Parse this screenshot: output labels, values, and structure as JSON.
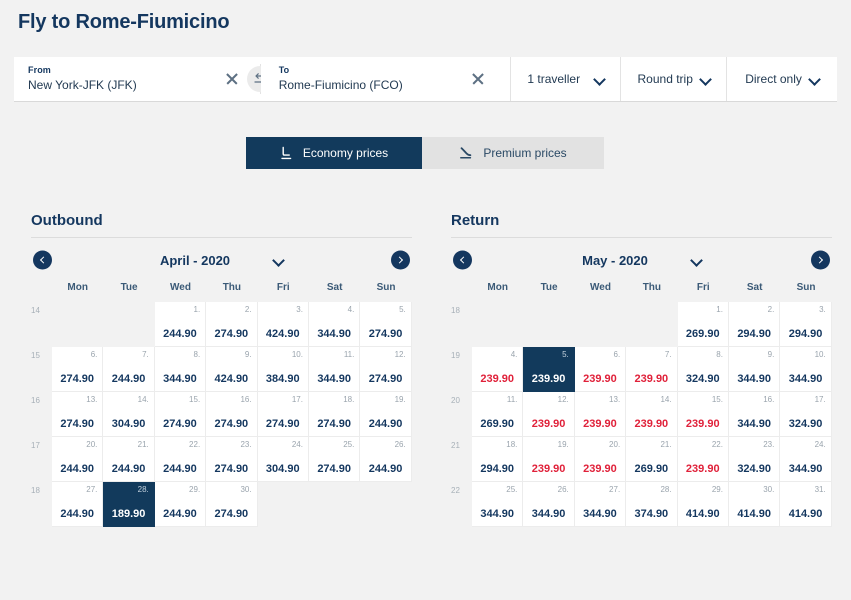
{
  "header": {
    "title": "Fly to Rome-Fiumicino"
  },
  "search": {
    "from_label": "From",
    "from_value": "New York-JFK (JFK)",
    "to_label": "To",
    "to_value": "Rome-Fiumicino (FCO)",
    "swap_icon": "swap-arrows-icon",
    "clear_icon": "close-icon",
    "travellers": "1 traveller",
    "trip_type": "Round trip",
    "direct": "Direct only"
  },
  "tabs": [
    {
      "label": "Economy prices",
      "icon": "economy-seat-icon",
      "active": true
    },
    {
      "label": "Premium prices",
      "icon": "premium-seat-icon",
      "active": false
    }
  ],
  "colors": {
    "navy": "#14375f",
    "selected": "#123a5c",
    "low_price": "#e0213a",
    "page_bg": "#f2f2f2",
    "tab_inactive": "#e2e2e2"
  },
  "calendars": [
    {
      "title": "Outbound",
      "month": "April - 2020",
      "prev_icon": "chevron-left-icon",
      "next_icon": "chevron-right-icon",
      "dropdown_icon": "chevron-down-icon",
      "dow": [
        "Mon",
        "Tue",
        "Wed",
        "Thu",
        "Fri",
        "Sat",
        "Sun"
      ],
      "weeks": [
        {
          "week": "14",
          "days": [
            null,
            null,
            {
              "d": "1.",
              "p": "244.90"
            },
            {
              "d": "2.",
              "p": "274.90"
            },
            {
              "d": "3.",
              "p": "424.90"
            },
            {
              "d": "4.",
              "p": "344.90"
            },
            {
              "d": "5.",
              "p": "274.90"
            }
          ]
        },
        {
          "week": "15",
          "days": [
            {
              "d": "6.",
              "p": "274.90"
            },
            {
              "d": "7.",
              "p": "244.90"
            },
            {
              "d": "8.",
              "p": "344.90"
            },
            {
              "d": "9.",
              "p": "424.90"
            },
            {
              "d": "10.",
              "p": "384.90"
            },
            {
              "d": "11.",
              "p": "344.90"
            },
            {
              "d": "12.",
              "p": "274.90"
            }
          ]
        },
        {
          "week": "16",
          "days": [
            {
              "d": "13.",
              "p": "274.90"
            },
            {
              "d": "14.",
              "p": "304.90"
            },
            {
              "d": "15.",
              "p": "274.90"
            },
            {
              "d": "16.",
              "p": "274.90"
            },
            {
              "d": "17.",
              "p": "274.90"
            },
            {
              "d": "18.",
              "p": "274.90"
            },
            {
              "d": "19.",
              "p": "244.90"
            }
          ]
        },
        {
          "week": "17",
          "days": [
            {
              "d": "20.",
              "p": "244.90"
            },
            {
              "d": "21.",
              "p": "244.90"
            },
            {
              "d": "22.",
              "p": "244.90"
            },
            {
              "d": "23.",
              "p": "274.90"
            },
            {
              "d": "24.",
              "p": "304.90"
            },
            {
              "d": "25.",
              "p": "274.90"
            },
            {
              "d": "26.",
              "p": "244.90"
            }
          ]
        },
        {
          "week": "18",
          "days": [
            {
              "d": "27.",
              "p": "244.90"
            },
            {
              "d": "28.",
              "p": "189.90",
              "selected": true
            },
            {
              "d": "29.",
              "p": "244.90"
            },
            {
              "d": "30.",
              "p": "274.90"
            },
            null,
            null,
            null
          ]
        }
      ]
    },
    {
      "title": "Return",
      "month": "May - 2020",
      "prev_icon": "chevron-left-icon",
      "next_icon": "chevron-right-icon",
      "dropdown_icon": "chevron-down-icon",
      "dow": [
        "Mon",
        "Tue",
        "Wed",
        "Thu",
        "Fri",
        "Sat",
        "Sun"
      ],
      "weeks": [
        {
          "week": "18",
          "days": [
            null,
            null,
            null,
            null,
            {
              "d": "1.",
              "p": "269.90"
            },
            {
              "d": "2.",
              "p": "294.90"
            },
            {
              "d": "3.",
              "p": "294.90"
            }
          ]
        },
        {
          "week": "19",
          "days": [
            {
              "d": "4.",
              "p": "239.90",
              "low": true
            },
            {
              "d": "5.",
              "p": "239.90",
              "selected": true
            },
            {
              "d": "6.",
              "p": "239.90",
              "low": true
            },
            {
              "d": "7.",
              "p": "239.90",
              "low": true
            },
            {
              "d": "8.",
              "p": "324.90"
            },
            {
              "d": "9.",
              "p": "344.90"
            },
            {
              "d": "10.",
              "p": "344.90"
            }
          ]
        },
        {
          "week": "20",
          "days": [
            {
              "d": "11.",
              "p": "269.90"
            },
            {
              "d": "12.",
              "p": "239.90",
              "low": true
            },
            {
              "d": "13.",
              "p": "239.90",
              "low": true
            },
            {
              "d": "14.",
              "p": "239.90",
              "low": true
            },
            {
              "d": "15.",
              "p": "239.90",
              "low": true
            },
            {
              "d": "16.",
              "p": "344.90"
            },
            {
              "d": "17.",
              "p": "324.90"
            }
          ]
        },
        {
          "week": "21",
          "days": [
            {
              "d": "18.",
              "p": "294.90"
            },
            {
              "d": "19.",
              "p": "239.90",
              "low": true
            },
            {
              "d": "20.",
              "p": "239.90",
              "low": true
            },
            {
              "d": "21.",
              "p": "269.90"
            },
            {
              "d": "22.",
              "p": "239.90",
              "low": true
            },
            {
              "d": "23.",
              "p": "324.90"
            },
            {
              "d": "24.",
              "p": "344.90"
            }
          ]
        },
        {
          "week": "22",
          "days": [
            {
              "d": "25.",
              "p": "344.90"
            },
            {
              "d": "26.",
              "p": "344.90"
            },
            {
              "d": "27.",
              "p": "344.90"
            },
            {
              "d": "28.",
              "p": "374.90"
            },
            {
              "d": "29.",
              "p": "414.90"
            },
            {
              "d": "30.",
              "p": "414.90"
            },
            {
              "d": "31.",
              "p": "414.90"
            }
          ]
        }
      ]
    }
  ]
}
